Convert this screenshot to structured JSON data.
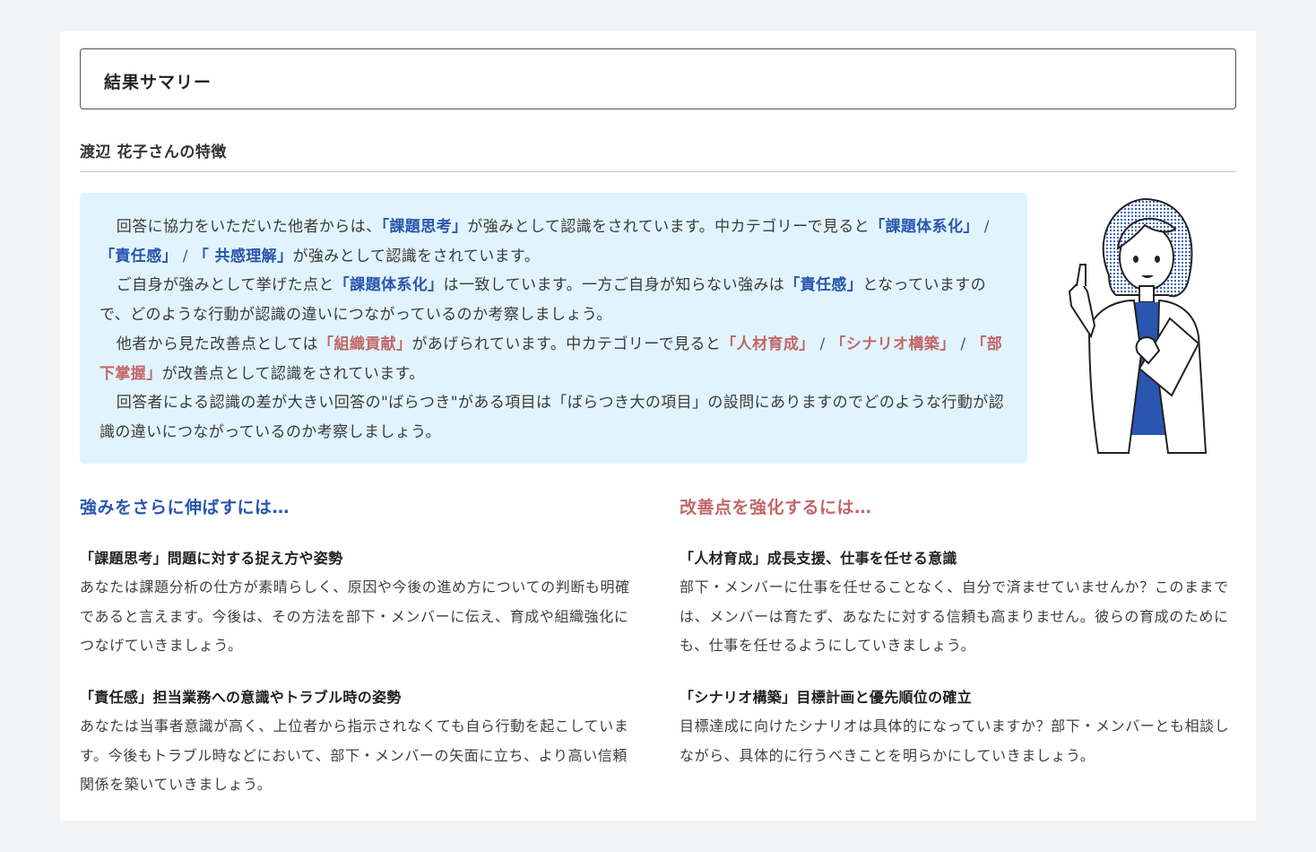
{
  "summary": {
    "title": "結果サマリー",
    "subtitle": "渡辺 花子さんの特徴"
  },
  "bubble": {
    "p1": {
      "pre": "回答に協力をいただいた他者からは、",
      "k1": "「課題思考」",
      "mid": "が強みとして認識をされています。中カテゴリーで見ると",
      "k2": "「課題体系化」",
      "s1": " / ",
      "k3": "「責任感」",
      "s2": " / ",
      "k4": "「 共感理解」",
      "post": "が強みとして認識をされています。"
    },
    "p2": {
      "pre": "ご自身が強みとして挙げた点と",
      "k1": "「課題体系化」",
      "mid": "は一致しています。一方ご自身が知らない強みは",
      "k2": "「責任感」",
      "post": "となっていますので、どのような行動が認識の違いにつながっているのか考察しましょう。"
    },
    "p3": {
      "pre": "他者から見た改善点としては",
      "k1": "「組織貢献」",
      "mid": "があげられています。中カテゴリーで見ると",
      "k2": "「人材育成」",
      "s1": " / ",
      "k3": "「シナリオ構築」",
      "s2": " / ",
      "k4": "「部下掌握」",
      "post": "が改善点として認識をされています。"
    },
    "p4": "回答者による認識の差が大きい回答の\"ばらつき\"がある項目は「ばらつき大の項目」の設問にありますのでどのような行動が認識の違いにつながっているのか考察しましょう。"
  },
  "strengths": {
    "heading": "強みをさらに伸ばすには…",
    "items": [
      {
        "title": "「課題思考」問題に対する捉え方や姿勢",
        "body": "あなたは課題分析の仕方が素晴らしく、原因や今後の進め方についての判断も明確であると言えます。今後は、その方法を部下・メンバーに伝え、育成や組織強化につなげていきましょう。"
      },
      {
        "title": "「責任感」担当業務への意識やトラブル時の姿勢",
        "body": "あなたは当事者意識が高く、上位者から指示されなくても自ら行動を起こしています。今後もトラブル時などにおいて、部下・メンバーの矢面に立ち、より高い信頼関係を築いていきましょう。"
      }
    ]
  },
  "improvements": {
    "heading": "改善点を強化するには…",
    "items": [
      {
        "title": "「人材育成」成長支援、仕事を任せる意識",
        "body": "部下・メンバーに仕事を任せることなく、自分で済ませていませんか？このままでは、メンバーは育たず、あなたに対する信頼も高まりません。彼らの育成のためにも、仕事を任せるようにしていきましょう。"
      },
      {
        "title": "「シナリオ構築」目標計画と優先順位の確立",
        "body": "目標達成に向けたシナリオは具体的になっていますか？部下・メンバーとも相談しながら、具体的に行うべきことを明らかにしていきましょう。"
      }
    ]
  },
  "colors": {
    "strength": "#2a56b0",
    "improvement": "#c26769",
    "bubble_bg": "#e1f3fd"
  }
}
